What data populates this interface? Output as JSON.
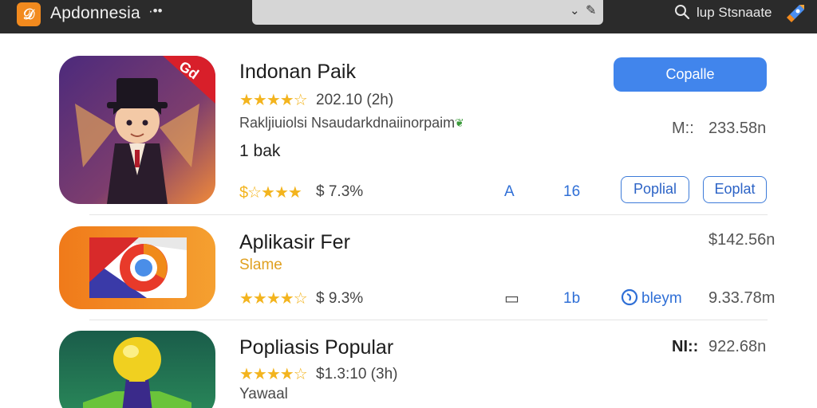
{
  "header": {
    "logo_glyph": "𝒟",
    "title": "Apdonnesia",
    "title_dots": "·••",
    "search_label": "lup Stsnaate",
    "icons": [
      "search-icon",
      "chevron-down-icon",
      "pen-icon",
      "rocket-icon"
    ]
  },
  "apps": [
    {
      "name": "Indonan Paik",
      "stars": "★★★★☆",
      "rating": "202.10 (2h)",
      "description": "Rakljiuiolsi Nsaudarkdnaiinorpaim",
      "tag": "1 bak",
      "stars2": "$☆★★★",
      "price": "$ 7.3%",
      "glyph_a": "A",
      "glyph_b": "16",
      "size_label": "M::",
      "size": "233.58n",
      "action": "Copalle",
      "btn_popular": "Poplial",
      "btn_explore": "Eoplat",
      "badge": "Gd"
    },
    {
      "name": "Aplikasir Fer",
      "subtitle": "Slame",
      "stars": "★★★★☆",
      "price": "$ 9.3%",
      "glyph_b": "1b",
      "link_label": "bleym",
      "size_top": "$142.56n",
      "size": "9.33.78m"
    },
    {
      "name": "Popliasis Popular",
      "stars": "★★★★☆",
      "rating": "$1.3:10 (3h)",
      "subtitle": "Yawaal",
      "size_label": "NI::",
      "size": "922.68n"
    }
  ],
  "colors": {
    "topbar": "#2b2b2b",
    "accent_blue": "#4185ec",
    "star": "#f3b41e",
    "logo_orange": "#f28a1e"
  }
}
